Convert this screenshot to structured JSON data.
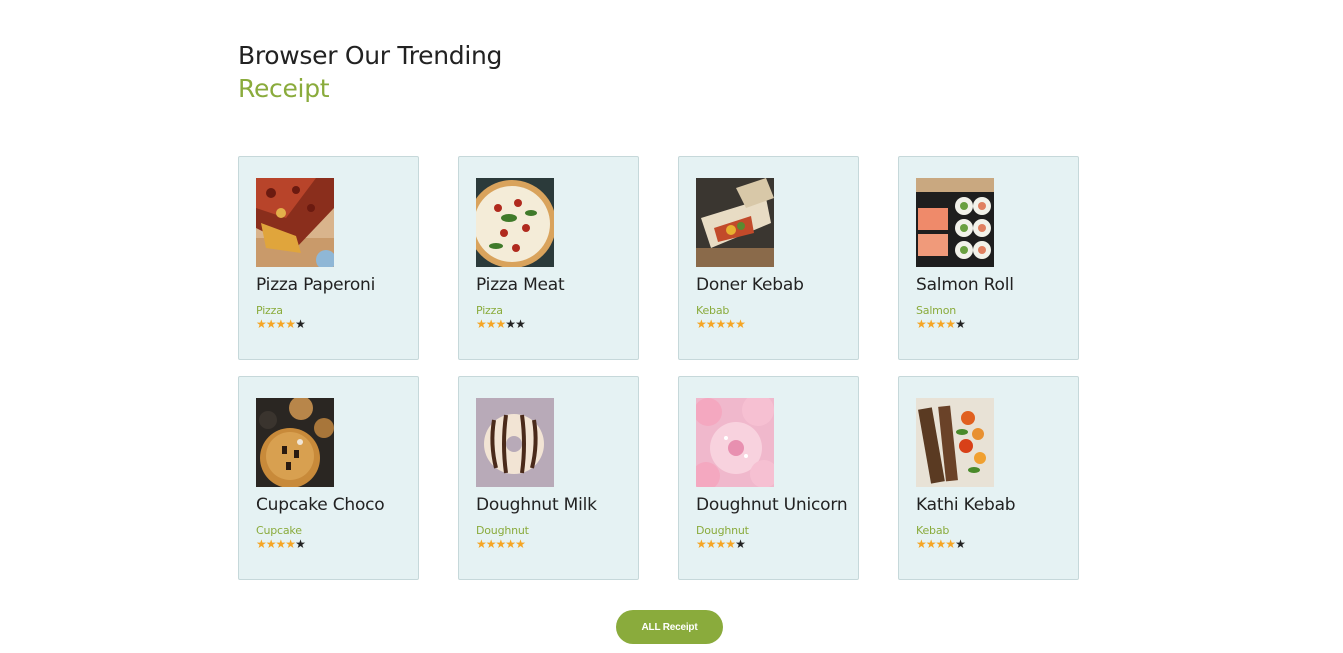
{
  "heading": {
    "line1": "Browser Our Trending",
    "line2": "Receipt"
  },
  "recipes": [
    {
      "name": "Pizza Paperoni",
      "category": "Pizza",
      "rating": 4,
      "rating_max": 5,
      "image": "pizza-pepperoni"
    },
    {
      "name": "Pizza Meat",
      "category": "Pizza",
      "rating": 3,
      "rating_max": 5,
      "image": "pizza-meat"
    },
    {
      "name": "Doner Kebab",
      "category": "Kebab",
      "rating": 5,
      "rating_max": 5,
      "image": "doner-kebab"
    },
    {
      "name": "Salmon Roll",
      "category": "Salmon",
      "rating": 4,
      "rating_max": 5,
      "image": "salmon-roll"
    },
    {
      "name": "Cupcake Choco",
      "category": "Cupcake",
      "rating": 4,
      "rating_max": 5,
      "image": "cupcake-choco"
    },
    {
      "name": "Doughnut Milk",
      "category": "Doughnut",
      "rating": 5,
      "rating_max": 5,
      "image": "doughnut-milk"
    },
    {
      "name": "Doughnut Unicorn",
      "category": "Doughnut",
      "rating": 4,
      "rating_max": 5,
      "image": "doughnut-unicorn"
    },
    {
      "name": "Kathi Kebab",
      "category": "Kebab",
      "rating": 4,
      "rating_max": 5,
      "image": "kathi-kebab"
    }
  ],
  "button": {
    "label": "ALL Receipt"
  },
  "colors": {
    "accent": "#8aab3c",
    "card_bg": "#e5f2f3",
    "star_on": "#f5a524",
    "star_off": "#222222"
  }
}
